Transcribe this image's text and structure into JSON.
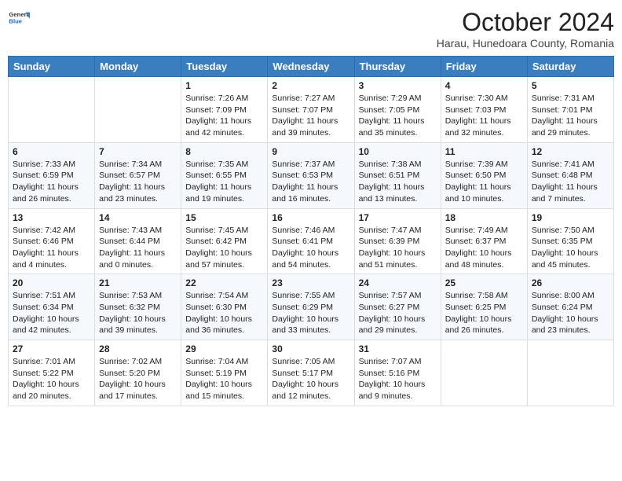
{
  "header": {
    "logo_line1": "General",
    "logo_line2": "Blue",
    "month": "October 2024",
    "location": "Harau, Hunedoara County, Romania"
  },
  "days_of_week": [
    "Sunday",
    "Monday",
    "Tuesday",
    "Wednesday",
    "Thursday",
    "Friday",
    "Saturday"
  ],
  "weeks": [
    [
      {
        "num": "",
        "info": ""
      },
      {
        "num": "",
        "info": ""
      },
      {
        "num": "1",
        "info": "Sunrise: 7:26 AM\nSunset: 7:09 PM\nDaylight: 11 hours and 42 minutes."
      },
      {
        "num": "2",
        "info": "Sunrise: 7:27 AM\nSunset: 7:07 PM\nDaylight: 11 hours and 39 minutes."
      },
      {
        "num": "3",
        "info": "Sunrise: 7:29 AM\nSunset: 7:05 PM\nDaylight: 11 hours and 35 minutes."
      },
      {
        "num": "4",
        "info": "Sunrise: 7:30 AM\nSunset: 7:03 PM\nDaylight: 11 hours and 32 minutes."
      },
      {
        "num": "5",
        "info": "Sunrise: 7:31 AM\nSunset: 7:01 PM\nDaylight: 11 hours and 29 minutes."
      }
    ],
    [
      {
        "num": "6",
        "info": "Sunrise: 7:33 AM\nSunset: 6:59 PM\nDaylight: 11 hours and 26 minutes."
      },
      {
        "num": "7",
        "info": "Sunrise: 7:34 AM\nSunset: 6:57 PM\nDaylight: 11 hours and 23 minutes."
      },
      {
        "num": "8",
        "info": "Sunrise: 7:35 AM\nSunset: 6:55 PM\nDaylight: 11 hours and 19 minutes."
      },
      {
        "num": "9",
        "info": "Sunrise: 7:37 AM\nSunset: 6:53 PM\nDaylight: 11 hours and 16 minutes."
      },
      {
        "num": "10",
        "info": "Sunrise: 7:38 AM\nSunset: 6:51 PM\nDaylight: 11 hours and 13 minutes."
      },
      {
        "num": "11",
        "info": "Sunrise: 7:39 AM\nSunset: 6:50 PM\nDaylight: 11 hours and 10 minutes."
      },
      {
        "num": "12",
        "info": "Sunrise: 7:41 AM\nSunset: 6:48 PM\nDaylight: 11 hours and 7 minutes."
      }
    ],
    [
      {
        "num": "13",
        "info": "Sunrise: 7:42 AM\nSunset: 6:46 PM\nDaylight: 11 hours and 4 minutes."
      },
      {
        "num": "14",
        "info": "Sunrise: 7:43 AM\nSunset: 6:44 PM\nDaylight: 11 hours and 0 minutes."
      },
      {
        "num": "15",
        "info": "Sunrise: 7:45 AM\nSunset: 6:42 PM\nDaylight: 10 hours and 57 minutes."
      },
      {
        "num": "16",
        "info": "Sunrise: 7:46 AM\nSunset: 6:41 PM\nDaylight: 10 hours and 54 minutes."
      },
      {
        "num": "17",
        "info": "Sunrise: 7:47 AM\nSunset: 6:39 PM\nDaylight: 10 hours and 51 minutes."
      },
      {
        "num": "18",
        "info": "Sunrise: 7:49 AM\nSunset: 6:37 PM\nDaylight: 10 hours and 48 minutes."
      },
      {
        "num": "19",
        "info": "Sunrise: 7:50 AM\nSunset: 6:35 PM\nDaylight: 10 hours and 45 minutes."
      }
    ],
    [
      {
        "num": "20",
        "info": "Sunrise: 7:51 AM\nSunset: 6:34 PM\nDaylight: 10 hours and 42 minutes."
      },
      {
        "num": "21",
        "info": "Sunrise: 7:53 AM\nSunset: 6:32 PM\nDaylight: 10 hours and 39 minutes."
      },
      {
        "num": "22",
        "info": "Sunrise: 7:54 AM\nSunset: 6:30 PM\nDaylight: 10 hours and 36 minutes."
      },
      {
        "num": "23",
        "info": "Sunrise: 7:55 AM\nSunset: 6:29 PM\nDaylight: 10 hours and 33 minutes."
      },
      {
        "num": "24",
        "info": "Sunrise: 7:57 AM\nSunset: 6:27 PM\nDaylight: 10 hours and 29 minutes."
      },
      {
        "num": "25",
        "info": "Sunrise: 7:58 AM\nSunset: 6:25 PM\nDaylight: 10 hours and 26 minutes."
      },
      {
        "num": "26",
        "info": "Sunrise: 8:00 AM\nSunset: 6:24 PM\nDaylight: 10 hours and 23 minutes."
      }
    ],
    [
      {
        "num": "27",
        "info": "Sunrise: 7:01 AM\nSunset: 5:22 PM\nDaylight: 10 hours and 20 minutes."
      },
      {
        "num": "28",
        "info": "Sunrise: 7:02 AM\nSunset: 5:20 PM\nDaylight: 10 hours and 17 minutes."
      },
      {
        "num": "29",
        "info": "Sunrise: 7:04 AM\nSunset: 5:19 PM\nDaylight: 10 hours and 15 minutes."
      },
      {
        "num": "30",
        "info": "Sunrise: 7:05 AM\nSunset: 5:17 PM\nDaylight: 10 hours and 12 minutes."
      },
      {
        "num": "31",
        "info": "Sunrise: 7:07 AM\nSunset: 5:16 PM\nDaylight: 10 hours and 9 minutes."
      },
      {
        "num": "",
        "info": ""
      },
      {
        "num": "",
        "info": ""
      }
    ]
  ]
}
